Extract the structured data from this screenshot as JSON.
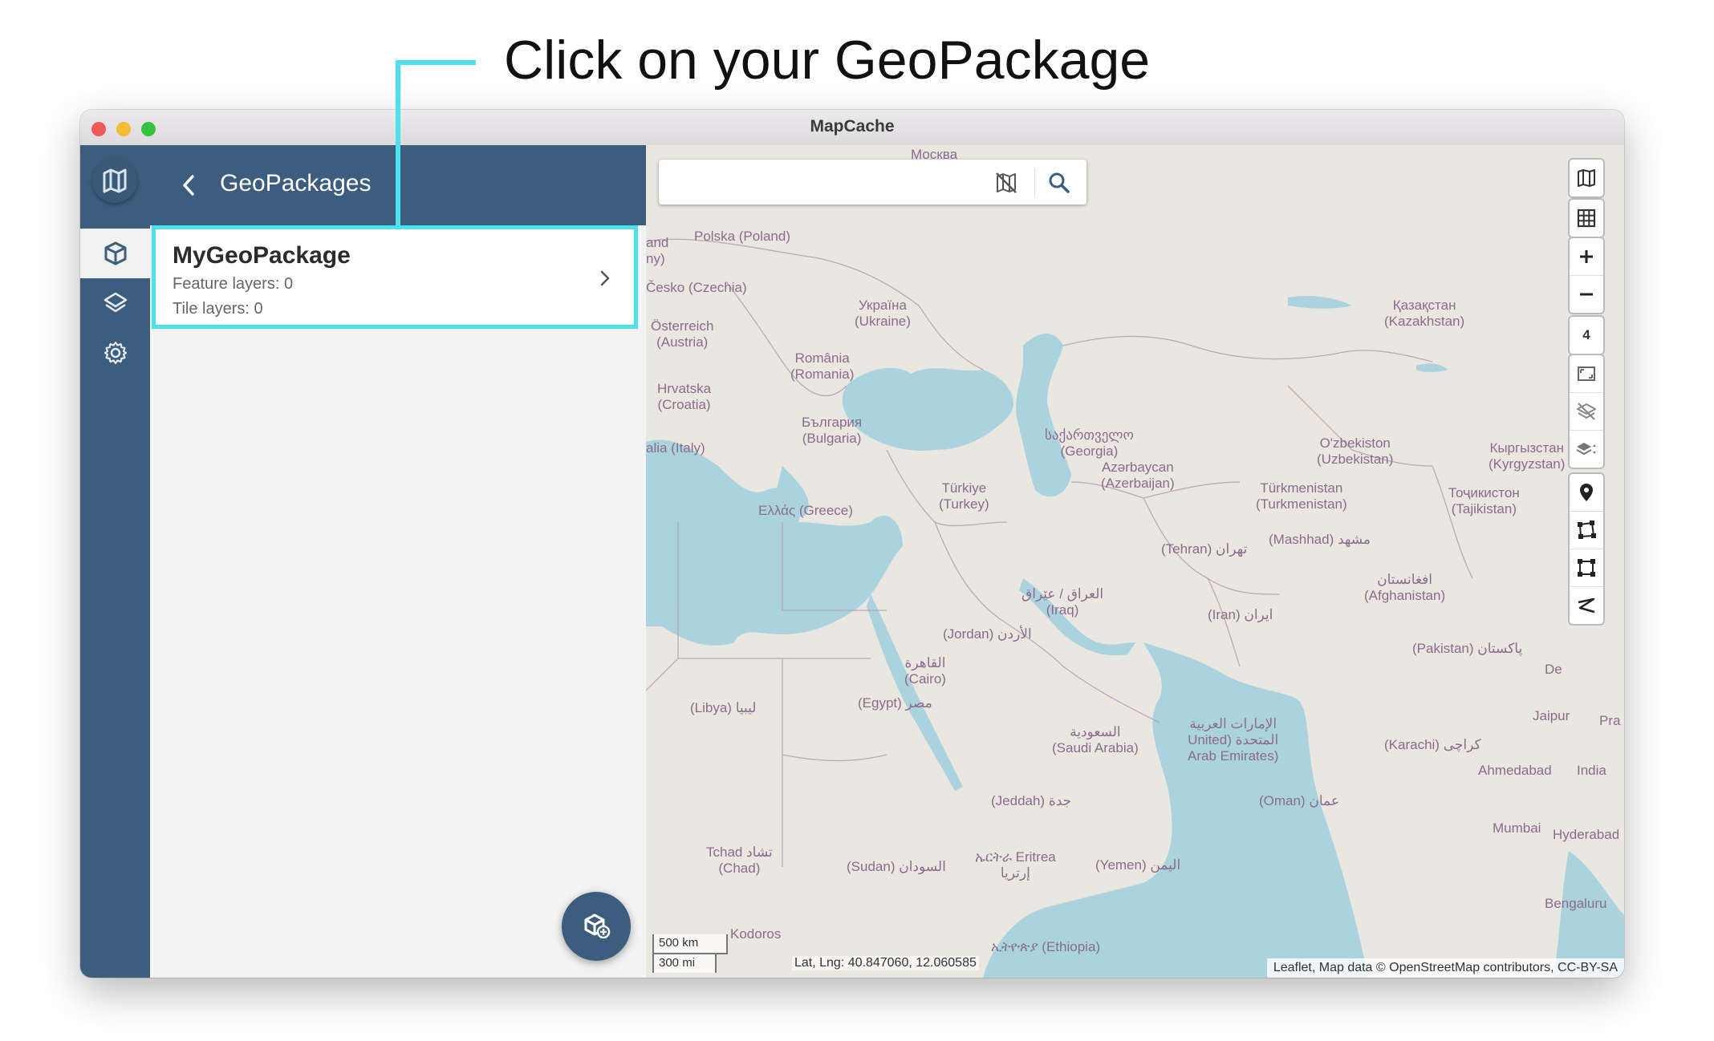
{
  "annotation": {
    "title": "Click on your GeoPackage"
  },
  "window": {
    "title": "MapCache"
  },
  "sidebar": {
    "items": [
      {
        "name": "geopackages",
        "icon": "cube-icon",
        "active": true
      },
      {
        "name": "layers",
        "icon": "layers-icon",
        "active": false
      },
      {
        "name": "settings",
        "icon": "gear-icon",
        "active": false
      }
    ]
  },
  "panel": {
    "title": "GeoPackages",
    "geopackage": {
      "name": "MyGeoPackage",
      "feature_layers": "Feature layers: 0",
      "tile_layers": "Tile layers: 0"
    }
  },
  "map": {
    "search": {
      "placeholder": "",
      "value": ""
    },
    "zoom_level": "4",
    "scale": {
      "metric": "500 km",
      "imperial": "300 mi"
    },
    "coordinates": "Lat, Lng: 40.847060, 12.060585",
    "attribution": "Leaflet, Map data © OpenStreetMap contributors, CC-BY-SA",
    "labels": {
      "moskva": "Москва",
      "poland": "Polska (Poland)",
      "czechia": "Česko (Czechia)",
      "austria": "Österreich\n(Austria)",
      "ukraine": "Україна\n(Ukraine)",
      "kazakhstan": "Қазақстан\n(Kazakhstan)",
      "romania": "România\n(Romania)",
      "croatia": "Hrvatska\n(Croatia)",
      "bulgaria": "България\n(Bulgaria)",
      "italy": "alia (Italy)",
      "georgia": "საქართველო\n(Georgia)",
      "uzbekistan": "O'zbekiston\n(Uzbekistan)",
      "kyrgyzstan": "Кыргызстан\n(Kyrgyzstan)",
      "azerbaijan": "Azərbaycan\n(Azerbaijan)",
      "turkey": "Türkiye\n(Turkey)",
      "greece": "Ελλάς (Greece)",
      "turkmenistan": "Türkmenistan\n(Turkmenistan)",
      "tajikistan": "Тоҷикистон\n(Tajikistan)",
      "mashhad": "(Mashhad) مشهد",
      "tehran": "(Tehran) تهران",
      "iraq": "العراق / عێراق\n(Iraq)",
      "afghanistan": "افغانستان\n(Afghanistan)",
      "iran": "(Iran) ایران",
      "jordan": "(Jordan) الأردن",
      "cairo": "القاهرة\n(Cairo)",
      "pakistan": "(Pakistan) پاکستان",
      "libya": "(Libya) ليبيا",
      "egypt": "(Egypt) مصر",
      "saudi": "السعودية\n(Saudi Arabia)",
      "uae": "الإمارات العربية\nUnited) المتحدة\nArab Emirates)",
      "karachi": "(Karachi) کراچی",
      "jaipur": "Jaipur",
      "ahmedabad": "Ahmedabad",
      "india": "India",
      "jeddah": "(Jeddah) جدة",
      "oman": "(Oman) عمان",
      "mumbai": "Mumbai",
      "hyderabad": "Hyderabad",
      "chad": "Tchad تشاد\n(Chad)",
      "sudan": "(Sudan) السودان",
      "eritrea": "ኤርትራ Eritrea\nإرتريا",
      "yemen": "(Yemen) اليمن",
      "bengaluru": "Bengaluru",
      "ethiopia": "ኢትዮጵያ (Ethiopia)",
      "kodoros": "Kodoros",
      "de": "De",
      "pra": "Pra",
      "and": "and\nny)"
    }
  },
  "colors": {
    "sidebar": "#3c5d7e",
    "highlight": "#4fe0ee",
    "water": "#aad3df",
    "land": "#e9e5df"
  }
}
